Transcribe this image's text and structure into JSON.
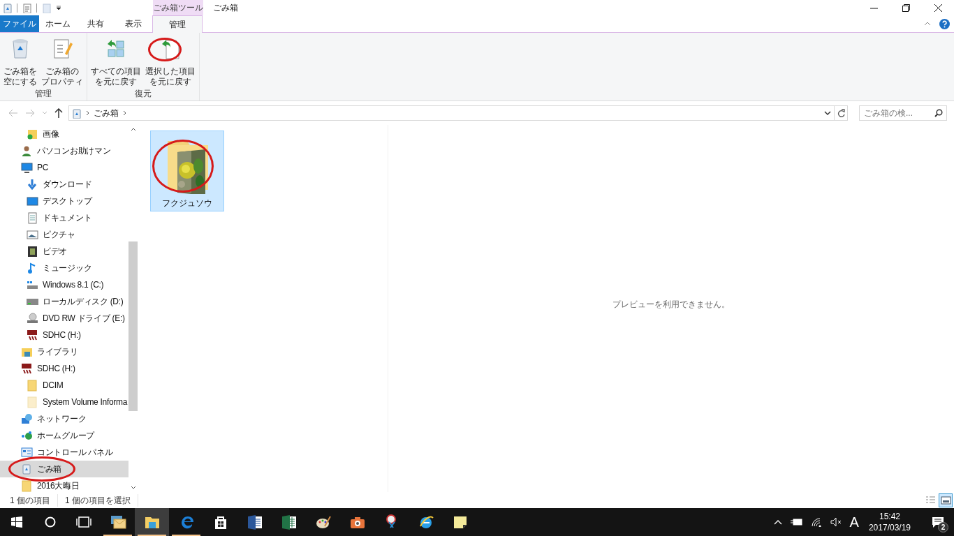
{
  "window": {
    "title": "ごみ箱",
    "context_tab_group": "ごみ箱ツール"
  },
  "quick_access": [
    {
      "kind": "recycle"
    },
    {
      "kind": "properties"
    },
    {
      "kind": "newfolder"
    }
  ],
  "tabs": [
    {
      "label": "ファイル",
      "kind": "file",
      "selected": false
    },
    {
      "label": "ホーム",
      "kind": "normal",
      "selected": false
    },
    {
      "label": "共有",
      "kind": "normal",
      "selected": false
    },
    {
      "label": "表示",
      "kind": "normal",
      "selected": false
    },
    {
      "label": "管理",
      "kind": "context",
      "selected": true
    }
  ],
  "ribbon_groups": [
    {
      "label": "管理",
      "buttons": [
        {
          "lines": [
            "ごみ箱を",
            "空にする"
          ],
          "kind": "empty_bin",
          "circled": false
        },
        {
          "lines": [
            "ごみ箱の",
            "プロパティ"
          ],
          "kind": "properties",
          "circled": false
        }
      ]
    },
    {
      "label": "復元",
      "buttons": [
        {
          "lines": [
            "すべての項目",
            "を元に戻す"
          ],
          "kind": "restore_all",
          "circled": false
        },
        {
          "lines": [
            "選択した項目",
            "を元に戻す"
          ],
          "kind": "restore_selected",
          "circled": true
        }
      ]
    }
  ],
  "address_bar": {
    "breadcrumb": "ごみ箱"
  },
  "search": {
    "placeholder": "ごみ箱の検..."
  },
  "nav_tree": [
    {
      "children": [
        {
          "label": "画像",
          "kind": "pictures_folder",
          "selected": false,
          "circled": false
        }
      ]
    },
    {
      "label": "パソコンお助けマン",
      "kind": "user",
      "selected": false,
      "circled": false
    },
    {
      "label": "PC",
      "kind": "pc",
      "selected": false,
      "circled": false,
      "children": [
        {
          "label": "ダウンロード",
          "kind": "download",
          "selected": false,
          "circled": false
        },
        {
          "label": "デスクトップ",
          "kind": "desktop",
          "selected": false,
          "circled": false
        },
        {
          "label": "ドキュメント",
          "kind": "document",
          "selected": false,
          "circled": false
        },
        {
          "label": "ピクチャ",
          "kind": "picture",
          "selected": false,
          "circled": false
        },
        {
          "label": "ビデオ",
          "kind": "video",
          "selected": false,
          "circled": false
        },
        {
          "label": "ミュージック",
          "kind": "music",
          "selected": false,
          "circled": false
        },
        {
          "label": "Windows 8.1 (C:)",
          "kind": "system_drive",
          "selected": false,
          "circled": false
        },
        {
          "label": "ローカルディスク (D:)",
          "kind": "drive",
          "selected": false,
          "circled": false
        },
        {
          "label": "DVD RW ドライブ (E:)",
          "kind": "dvd",
          "selected": false,
          "circled": false
        },
        {
          "label": "SDHC (H:)",
          "kind": "sd",
          "selected": false,
          "circled": false
        }
      ]
    },
    {
      "label": "ライブラリ",
      "kind": "library",
      "selected": false,
      "circled": false
    },
    {
      "label": "SDHC (H:)",
      "kind": "sd",
      "selected": false,
      "circled": false,
      "children": [
        {
          "label": "DCIM",
          "kind": "folder",
          "selected": false,
          "circled": false
        },
        {
          "label": "System Volume Informa",
          "kind": "hidden_folder",
          "selected": false,
          "circled": false
        }
      ]
    },
    {
      "label": "ネットワーク",
      "kind": "network",
      "selected": false,
      "circled": false
    },
    {
      "label": "ホームグループ",
      "kind": "homegroup",
      "selected": false,
      "circled": false
    },
    {
      "label": "コントロール パネル",
      "kind": "control_panel",
      "selected": false,
      "circled": false
    },
    {
      "label": "ごみ箱",
      "kind": "recycle",
      "selected": true,
      "circled": true
    },
    {
      "label": "2016大晦日",
      "kind": "folder",
      "selected": false,
      "circled": false
    }
  ],
  "files": [
    {
      "name": "フクジュソウ",
      "kind": "photo_folder",
      "selected": true,
      "circled": true
    }
  ],
  "preview": {
    "message": "プレビューを利用できません。"
  },
  "status_bar": {
    "item_count": "1 個の項目",
    "selection": "1 個の項目を選択"
  },
  "view_buttons": [
    {
      "kind": "details",
      "selected": false
    },
    {
      "kind": "large_icons",
      "selected": true
    }
  ],
  "taskbar": {
    "apps": [
      {
        "kind": "mail",
        "running": true,
        "active": false
      },
      {
        "kind": "explorer",
        "running": true,
        "active": true
      },
      {
        "kind": "edge",
        "running": true,
        "active": false
      },
      {
        "kind": "store",
        "running": false,
        "active": false
      },
      {
        "kind": "word",
        "running": false,
        "active": false
      },
      {
        "kind": "excel",
        "running": false,
        "active": false
      },
      {
        "kind": "paint",
        "running": false,
        "active": false
      },
      {
        "kind": "camera",
        "running": false,
        "active": false
      },
      {
        "kind": "snipping",
        "running": false,
        "active": false
      },
      {
        "kind": "ie",
        "running": false,
        "active": false
      },
      {
        "kind": "sticky",
        "running": false,
        "active": false
      }
    ],
    "ime": "A",
    "time": "15:42",
    "date": "2017/03/19",
    "notification_count": "2"
  }
}
